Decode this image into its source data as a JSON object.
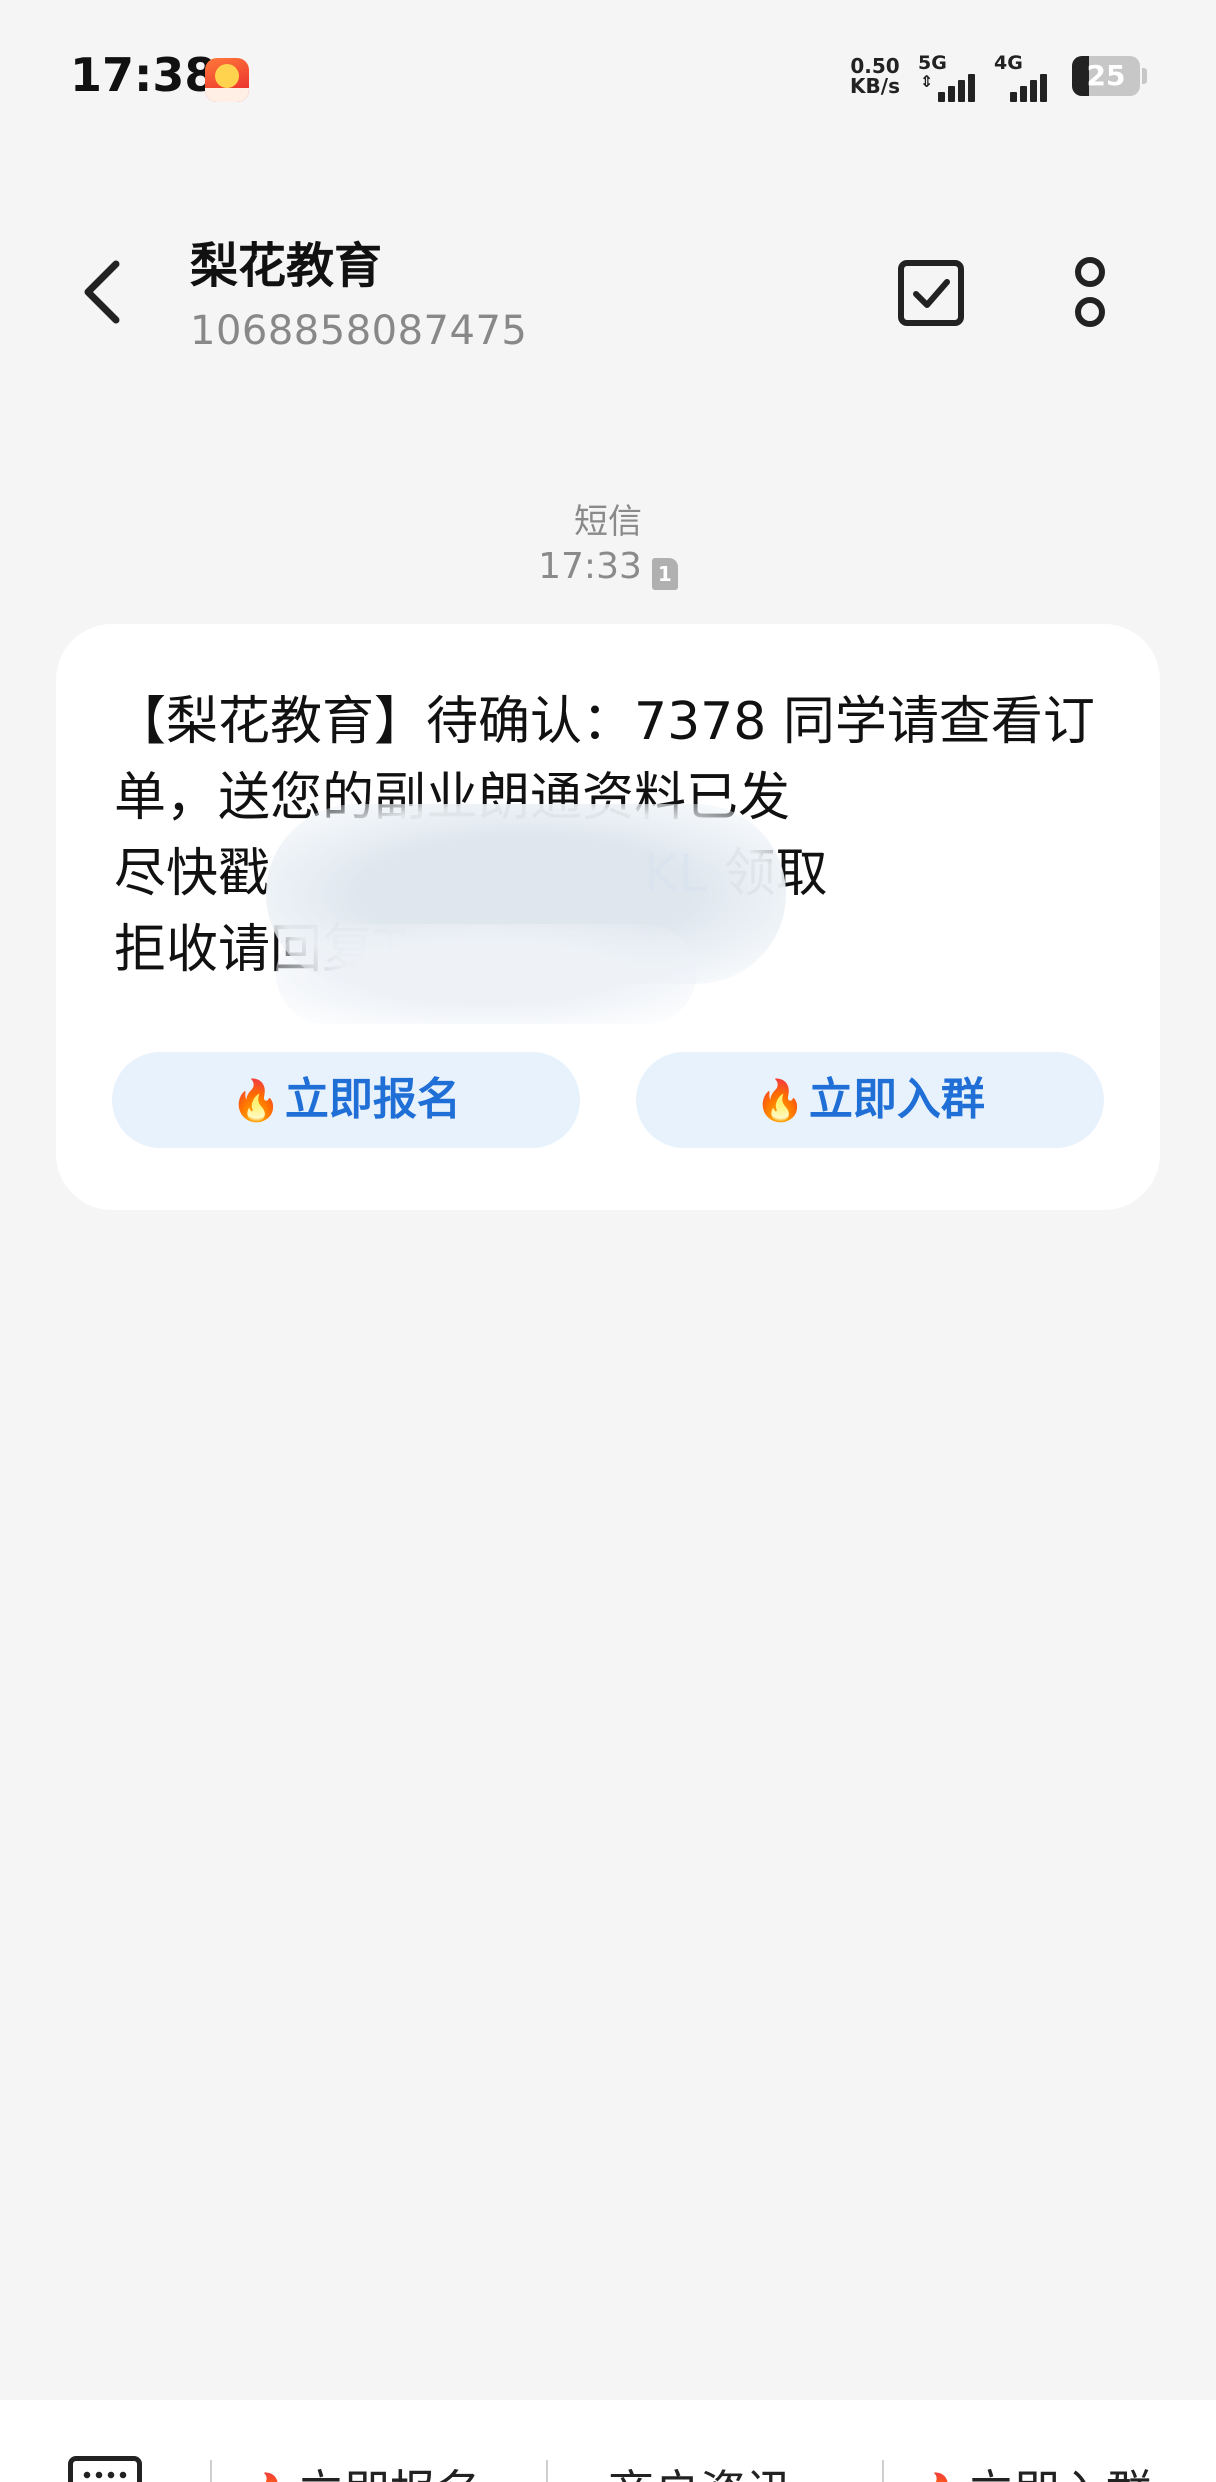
{
  "status_bar": {
    "time": "17:38",
    "net_speed_value": "0.50",
    "net_speed_unit": "KB/s",
    "signal_1_label": "5G",
    "signal_2_label": "4G",
    "battery_level": "25"
  },
  "header": {
    "contact_name": "梨花教育",
    "contact_number": "1068858087475"
  },
  "message": {
    "type_label": "短信",
    "time": "17:33",
    "sim_label": "1",
    "line1": "【梨花教育】待确认：7378 同学请查看订",
    "line2": "单，送您的副业朗通资料已发",
    "line3_prefix": "尽快戳",
    "line3_link": "KL",
    "line3_suffix": " 领取",
    "line4": "拒收请回复T",
    "actions": [
      {
        "label": "立即报名"
      },
      {
        "label": "立即入群"
      }
    ]
  },
  "quick_menu": {
    "items": [
      {
        "label": "立即报名"
      },
      {
        "label": "商户资讯"
      },
      {
        "label": "立即入群"
      }
    ]
  },
  "colors": {
    "accent": "#1f6fd6",
    "chip_bg": "#e8f2fc",
    "background": "#f5f5f5"
  }
}
